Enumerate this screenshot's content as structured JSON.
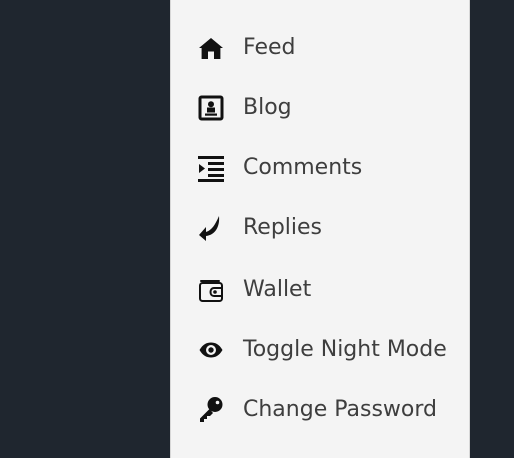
{
  "background_color": "#1f262f",
  "panel_color": "#f4f4f4",
  "text_color": "#3e3e3e",
  "menu": {
    "items": [
      {
        "label": "Feed",
        "icon": "home-icon"
      },
      {
        "label": "Blog",
        "icon": "blog-icon"
      },
      {
        "label": "Comments",
        "icon": "comments-icon"
      },
      {
        "label": "Replies",
        "icon": "reply-icon"
      },
      {
        "label": "Wallet",
        "icon": "wallet-icon"
      },
      {
        "label": "Toggle Night Mode",
        "icon": "eye-icon"
      },
      {
        "label": "Change Password",
        "icon": "key-icon"
      }
    ]
  }
}
